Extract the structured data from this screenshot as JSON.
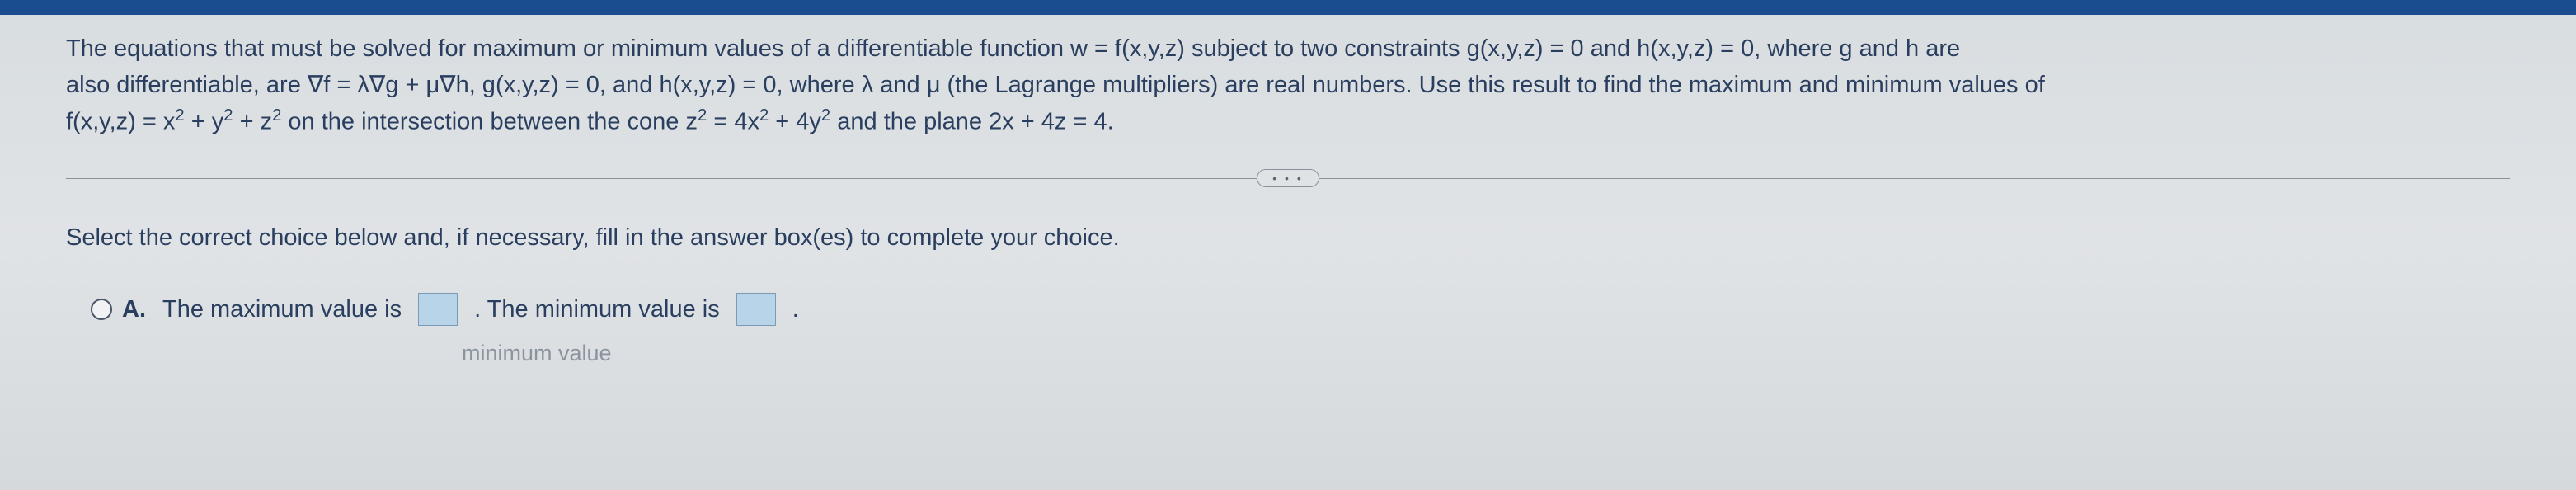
{
  "problem": {
    "line1_part1": "The equations that must be solved for maximum or minimum values of a differentiable function w = f(x,y,z) subject to two constraints g(x,y,z) = 0 and h(x,y,z) = 0, where g and h are",
    "line2_part1": "also differentiable, are ∇f = λ∇g + μ∇h, g(x,y,z) = 0, and h(x,y,z) = 0, where λ and μ (the Lagrange multipliers) are real numbers. Use this result to find the maximum and minimum values of",
    "line3_prefix": "f(x,y,z) = x",
    "line3_mid1": " + y",
    "line3_mid2": " + z",
    "line3_mid3": " on the intersection between the cone z",
    "line3_mid4": " = 4x",
    "line3_mid5": " + 4y",
    "line3_suffix": " and the plane 2x + 4z = 4.",
    "exp2": "2"
  },
  "divider_dots": "• • •",
  "instruction": "Select the correct choice below and, if necessary, fill in the answer box(es) to complete your choice.",
  "choice_a": {
    "label": "A.",
    "text_max": "The maximum value is",
    "text_min": ". The minimum value is",
    "text_end": "."
  },
  "faded": "minimum value"
}
